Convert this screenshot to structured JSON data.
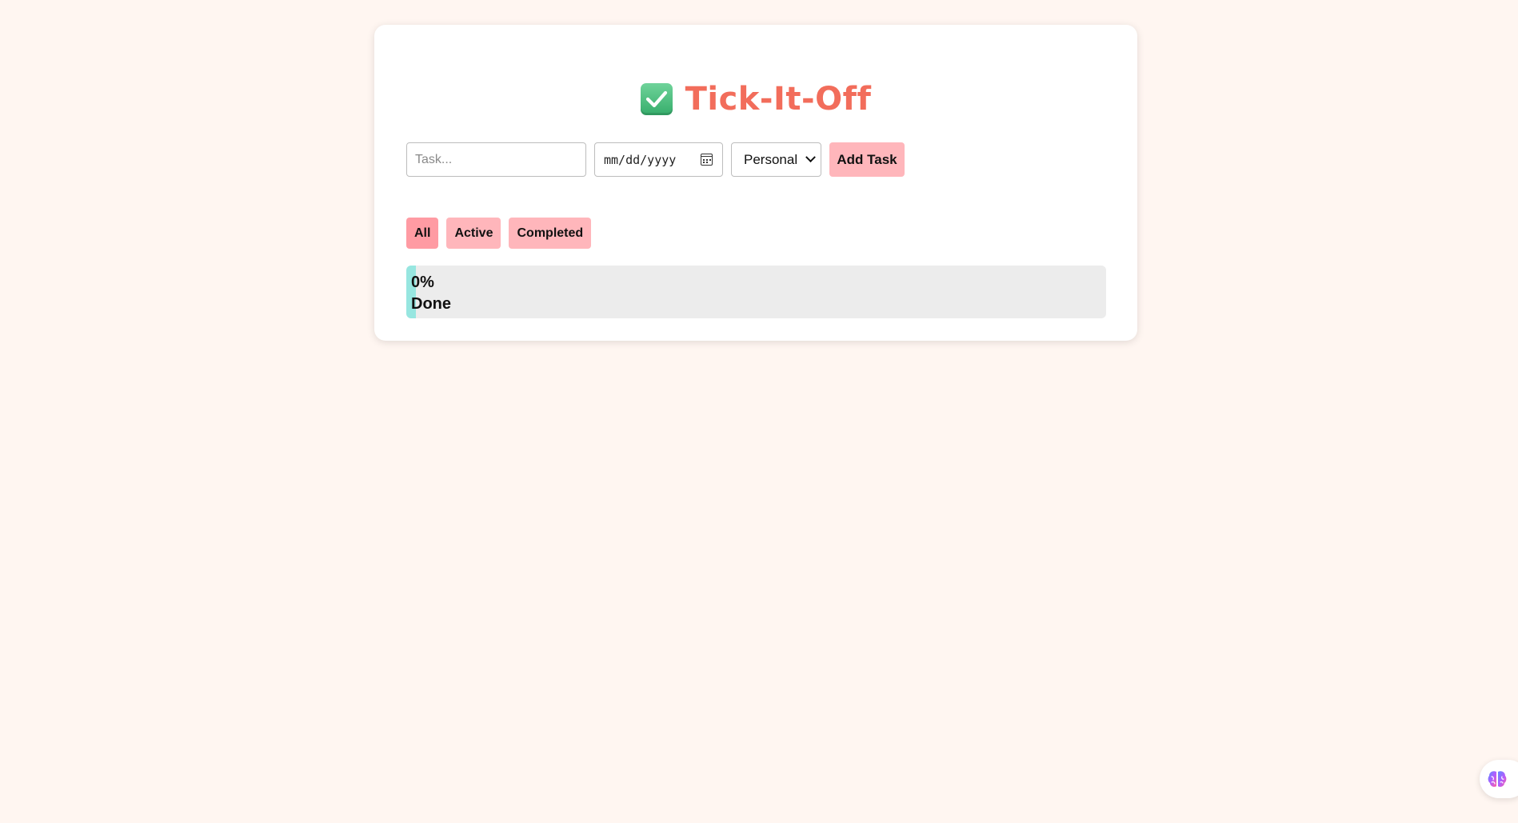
{
  "app": {
    "title": "Tick-It-Off",
    "title_icon": "check-box-icon"
  },
  "form": {
    "task_placeholder": "Task...",
    "task_value": "",
    "date_placeholder": "mm/dd/yyyy",
    "category_selected": "Personal",
    "add_label": "Add Task"
  },
  "filters": {
    "all": "All",
    "active": "Active",
    "completed": "Completed",
    "selected": "All"
  },
  "progress": {
    "percent_text": "0%",
    "done_text": "Done",
    "value": 0
  },
  "floating": {
    "icon": "brain-icon"
  },
  "colors": {
    "background": "#fff6f1",
    "title": "#f26d5b",
    "button": "#ffb6bb",
    "button_active": "#ff9ba3",
    "progress_fill": "#97e6e0",
    "progress_track": "#ececec"
  }
}
